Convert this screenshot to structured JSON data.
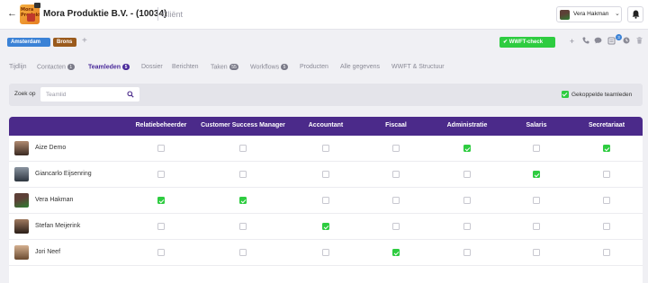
{
  "header": {
    "logo_text": "Mora Produktie",
    "title": "Mora Produktie B.V. - (10034)",
    "subtitle": "Cliënt",
    "user_name": "Vera Hakman"
  },
  "tags": {
    "items": [
      "Amsterdam",
      "Brons"
    ],
    "add_label": "+"
  },
  "toolbar": {
    "wwft_label": "✔ WWFT-check",
    "notification_count": "3",
    "icons": [
      "plus-icon",
      "phone-icon",
      "chat-icon",
      "document-icon",
      "clock-icon",
      "trash-icon"
    ]
  },
  "tabs": [
    {
      "label": "Tijdlijn",
      "count": ""
    },
    {
      "label": "Contacten",
      "count": "1"
    },
    {
      "label": "Teamleden",
      "count": "5"
    },
    {
      "label": "Dossier",
      "count": ""
    },
    {
      "label": "Berichten",
      "count": ""
    },
    {
      "label": "Taken",
      "count": "55"
    },
    {
      "label": "Workflows",
      "count": "5"
    },
    {
      "label": "Producten",
      "count": ""
    },
    {
      "label": "Alle gegevens",
      "count": ""
    },
    {
      "label": "WWFT & Structuur",
      "count": ""
    }
  ],
  "filter": {
    "label": "Zoek op",
    "placeholder": "Teamlid",
    "linked_label": "Gekoppelde teamleden"
  },
  "table": {
    "columns": [
      "Relatiebeheerder",
      "Customer Success Manager",
      "Accountant",
      "Fiscaal",
      "Administratie",
      "Salaris",
      "Secretariaat"
    ],
    "rows": [
      {
        "name": "Aize Demo",
        "checks": [
          false,
          false,
          false,
          false,
          true,
          false,
          true
        ]
      },
      {
        "name": "Giancarlo Eijsenring",
        "checks": [
          false,
          false,
          false,
          false,
          false,
          true,
          false
        ]
      },
      {
        "name": "Vera Hakman",
        "checks": [
          true,
          true,
          false,
          false,
          false,
          false,
          false
        ]
      },
      {
        "name": "Stefan Meijerink",
        "checks": [
          false,
          false,
          true,
          false,
          false,
          false,
          false
        ]
      },
      {
        "name": "Jori Neef",
        "checks": [
          false,
          false,
          false,
          true,
          false,
          false,
          false
        ]
      }
    ]
  },
  "colors": {
    "accent": "#4b2a8a",
    "success": "#2ecc40",
    "tag_blue": "#3b82d6",
    "tag_brown": "#9a5a1c"
  }
}
